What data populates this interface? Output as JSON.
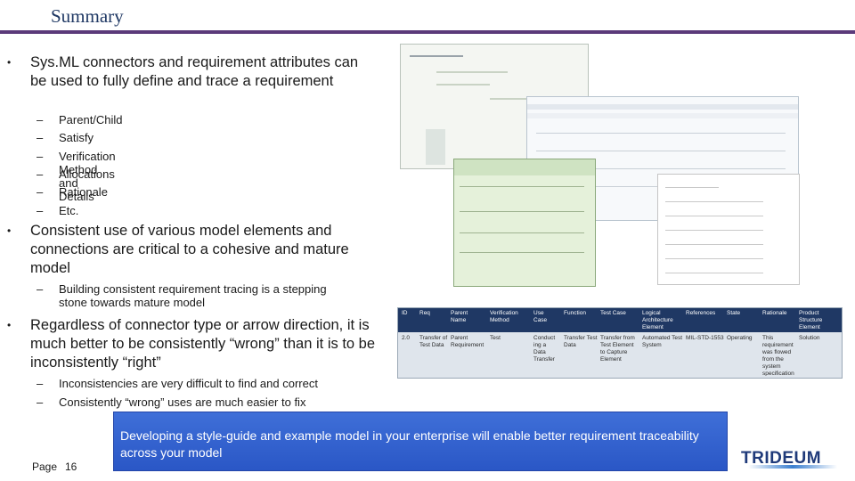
{
  "title": "Summary",
  "bullets": [
    {
      "text": "Sys.ML connectors and requirement attributes can be used to fully define and trace a requirement",
      "subitems": [
        "Parent/Child",
        "Satisfy",
        "Verification Method and Details",
        "Allocations",
        "Rationale",
        "Etc."
      ]
    },
    {
      "text": "Consistent use of various model elements and connections are critical to a cohesive and mature model",
      "subitems": [
        "Building consistent requirement tracing is a stepping stone towards mature model"
      ]
    },
    {
      "text": "Regardless of connector type or arrow direction, it is much better to be consistently “wrong” than it is to be inconsistently “right”",
      "subitems": [
        "Inconsistencies are very difficult to find and correct",
        "Consistently “wrong” uses are much easier to fix"
      ]
    }
  ],
  "requirement_table": {
    "headers": [
      "ID",
      "Req",
      "Parent Name",
      "Verification Method",
      "Use Case",
      "Function",
      "Test Case",
      "Logical Architecture Element",
      "References",
      "State",
      "Rationale",
      "Product Structure Element"
    ],
    "row": [
      "2.0",
      "Transfer of Test Data",
      "Parent Requirement",
      "Test",
      "Conduct ing a Data Transfer",
      "Transfer Test Data",
      "Transfer from Test Element to Capture Element",
      "Automated Test System",
      "MIL-STD-1553",
      "Operating",
      "This requirement was flowed from the system specification ...",
      "Solution"
    ]
  },
  "callout": "Developing a style-guide and example model in your enterprise will enable better requirement traceability across your model",
  "footer": {
    "page_label": "Page",
    "page_number": "16"
  },
  "logo": "TRIDEUM",
  "colors": {
    "title": "#1f3864",
    "rule": "#5b3a7a",
    "callout": "#2a57c6",
    "table_header": "#1f3864"
  }
}
